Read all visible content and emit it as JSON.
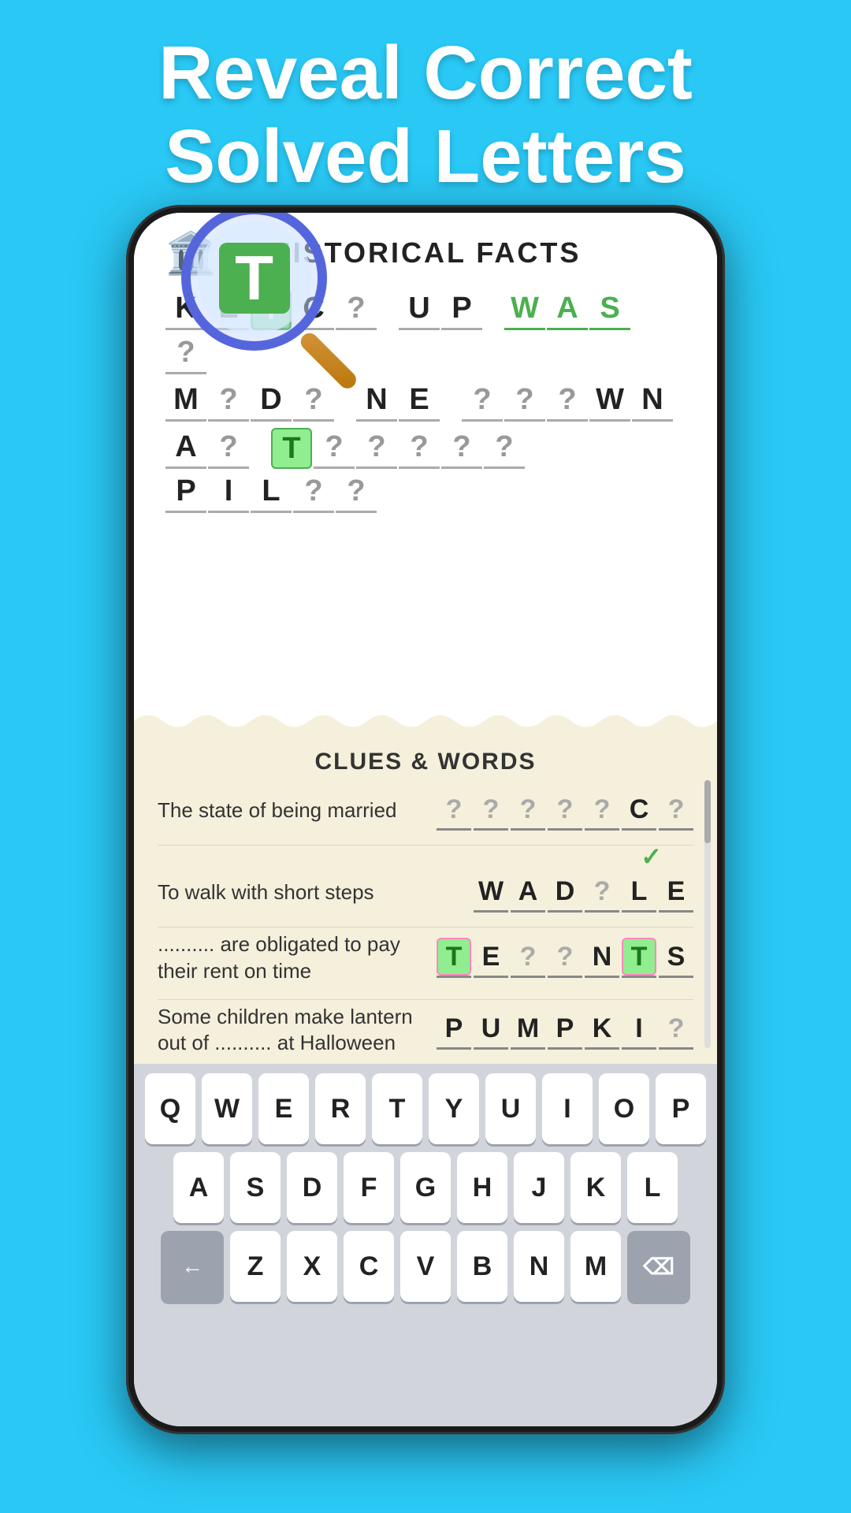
{
  "header": {
    "line1": "Reveal Correct",
    "line2": "Solved Letters"
  },
  "game": {
    "title": "HISTORICAL FACTS",
    "icon": "🏛️",
    "puzzle_rows": [
      {
        "words": [
          {
            "letters": [
              "K",
              "E",
              "T",
              "C",
              "?"
            ],
            "highlights": [
              {
                "index": 2,
                "type": "green"
              }
            ]
          },
          {
            "letters": [
              "U",
              "P"
            ]
          },
          {
            "letters": [
              "W",
              "A",
              "S"
            ],
            "color": "green"
          },
          {
            "letters": [
              "?"
            ]
          }
        ]
      },
      {
        "words": [
          {
            "letters": [
              "M",
              "?",
              "D",
              "?"
            ]
          },
          {
            "letters": [
              "N",
              "E"
            ]
          },
          {
            "letters": [
              "?",
              "?",
              "?",
              "W",
              "N"
            ]
          }
        ]
      },
      {
        "words": [
          {
            "letters": [
              "A",
              "?"
            ]
          },
          {
            "letters": [
              "T",
              "?",
              "?",
              "?",
              "?",
              "?"
            ],
            "highlights": [
              {
                "index": 0,
                "type": "green-box"
              }
            ]
          },
          {
            "letters": [
              "P",
              "I",
              "L",
              "?",
              "?"
            ]
          }
        ]
      }
    ],
    "clues_title": "CLUES & WORDS",
    "clues": [
      {
        "text": "The state of being married",
        "answer": [
          "?",
          "?",
          "?",
          "?",
          "?",
          "C",
          "?"
        ],
        "answer_types": [
          "gray",
          "gray",
          "gray",
          "gray",
          "gray",
          "normal",
          "gray"
        ],
        "checkmark": false
      },
      {
        "text": "To walk with short steps",
        "answer": [
          "W",
          "A",
          "D",
          "?",
          "L",
          "E"
        ],
        "answer_types": [
          "normal",
          "normal",
          "normal",
          "gray",
          "normal",
          "normal"
        ],
        "checkmark": true
      },
      {
        "text": ".......... are obligated to pay their rent on time",
        "answer": [
          "T",
          "E",
          "?",
          "?",
          "N",
          "T",
          "S"
        ],
        "answer_types": [
          "pink-green",
          "normal",
          "gray",
          "gray",
          "normal",
          "pink-green",
          "normal"
        ],
        "checkmark": false
      },
      {
        "text": "Some children make lantern out of .......... at Halloween",
        "answer": [
          "P",
          "U",
          "M",
          "P",
          "K",
          "I",
          "?"
        ],
        "answer_types": [
          "normal",
          "normal",
          "normal",
          "normal",
          "normal",
          "normal",
          "gray"
        ],
        "checkmark": false
      }
    ]
  },
  "keyboard": {
    "rows": [
      [
        "Q",
        "W",
        "E",
        "R",
        "T",
        "Y",
        "U",
        "I",
        "O",
        "P"
      ],
      [
        "A",
        "S",
        "D",
        "F",
        "G",
        "H",
        "J",
        "K",
        "L"
      ],
      [
        "←",
        "Z",
        "X",
        "C",
        "V",
        "B",
        "N",
        "M",
        "⌫"
      ]
    ]
  }
}
